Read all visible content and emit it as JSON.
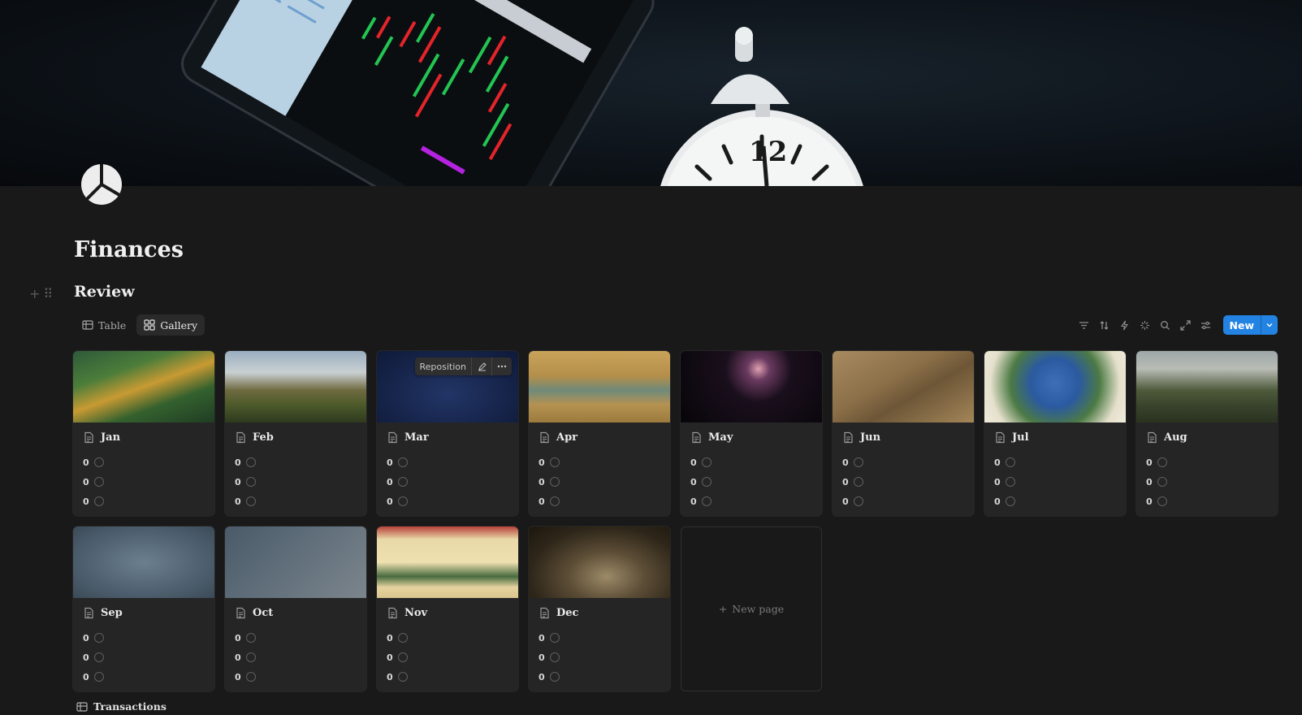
{
  "page": {
    "title": "Finances"
  },
  "section": {
    "title": "Review"
  },
  "views": [
    {
      "label": "Table",
      "icon": "table-icon"
    },
    {
      "label": "Gallery",
      "icon": "gallery-icon"
    }
  ],
  "toolbar": {
    "icons": [
      "filter-icon",
      "sort-icon",
      "automation-icon",
      "ai-icon",
      "search-icon",
      "expand-icon",
      "settings-icon"
    ],
    "new_label": "New"
  },
  "cards": [
    {
      "title": "Jan",
      "props": [
        "0",
        "0",
        "0"
      ],
      "cover": "jungle-painting"
    },
    {
      "title": "Feb",
      "props": [
        "0",
        "0",
        "0"
      ],
      "cover": "mountain-landscape"
    },
    {
      "title": "Mar",
      "props": [
        "0",
        "0",
        "0"
      ],
      "cover": "dark-blue-texture"
    },
    {
      "title": "Apr",
      "props": [
        "0",
        "0",
        "0"
      ],
      "cover": "chinese-landscape-scroll"
    },
    {
      "title": "May",
      "props": [
        "0",
        "0",
        "0"
      ],
      "cover": "galaxy-image"
    },
    {
      "title": "Jun",
      "props": [
        "0",
        "0",
        "0"
      ],
      "cover": "sepia-bird-drawing"
    },
    {
      "title": "Jul",
      "props": [
        "0",
        "0",
        "0"
      ],
      "cover": "irises-painting"
    },
    {
      "title": "Aug",
      "props": [
        "0",
        "0",
        "0"
      ],
      "cover": "landscape-painting"
    },
    {
      "title": "Sep",
      "props": [
        "0",
        "0",
        "0"
      ],
      "cover": "blue-grey-texture"
    },
    {
      "title": "Oct",
      "props": [
        "0",
        "0",
        "0"
      ],
      "cover": "grey-gradient"
    },
    {
      "title": "Nov",
      "props": [
        "0",
        "0",
        "0"
      ],
      "cover": "japanese-woodblock"
    },
    {
      "title": "Dec",
      "props": [
        "0",
        "0",
        "0"
      ],
      "cover": "still-life-painting"
    }
  ],
  "cover_controls": {
    "reposition_label": "Reposition"
  },
  "new_page_label": "New page",
  "linked_db": {
    "label": "Transactions"
  },
  "colors": {
    "accent": "#2383e2",
    "background": "#191919",
    "card": "#252525"
  }
}
